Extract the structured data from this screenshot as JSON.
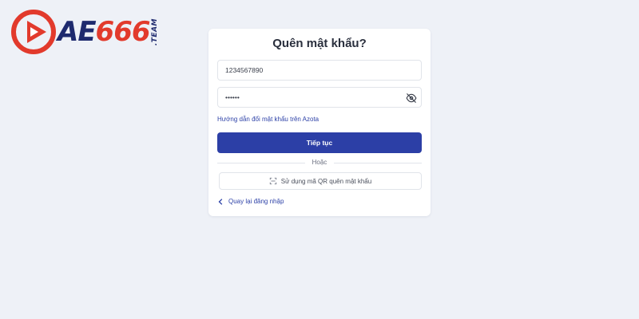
{
  "brand": {
    "name_prefix": "AE",
    "name_digits": "666",
    "suffix": ".TEAM",
    "colors": {
      "navy": "#1e2a6e",
      "red": "#e23a2c"
    }
  },
  "form": {
    "title": "Quên mật khẩu?",
    "phone_value": "1234567890",
    "password_value": "••••••",
    "password_toggle_icon": "eye-off-icon",
    "guide_link": "Hướng dẫn đổi mật khẩu trên Azota",
    "continue_label": "Tiếp tục",
    "or_label": "Hoặc",
    "qr_label": "Sử dụng mã QR quên mật khẩu",
    "qr_icon": "qr-scan-icon",
    "back_label": "Quay lại đăng nhập",
    "back_icon": "chevron-left-icon"
  },
  "colors": {
    "page_bg": "#eef1f7",
    "primary": "#2c3fa6",
    "link": "#2f43a8"
  }
}
